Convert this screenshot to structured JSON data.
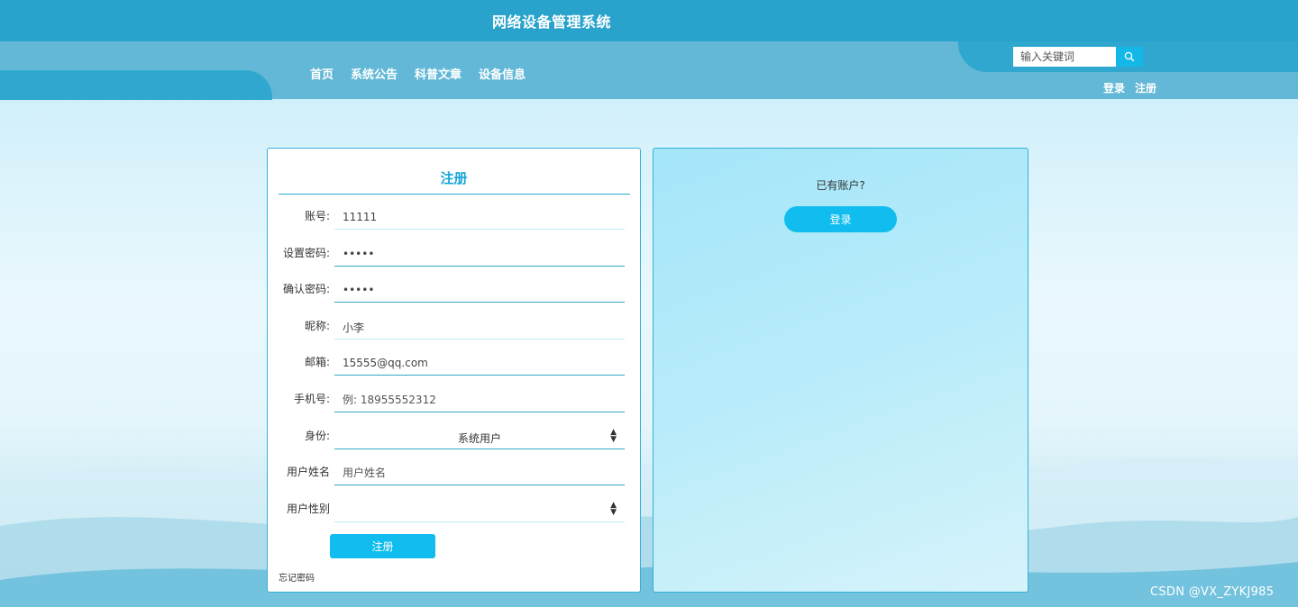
{
  "header": {
    "site_title": "网络设备管理系统",
    "nav_items": [
      "首页",
      "系统公告",
      "科普文章",
      "设备信息"
    ],
    "search_placeholder": "输入关键词",
    "login_link": "登录",
    "register_link": "注册"
  },
  "register_form": {
    "title": "注册",
    "fields": [
      {
        "label": "账号:",
        "value": "11111",
        "type": "text"
      },
      {
        "label": "设置密码:",
        "value": "•••••",
        "type": "password"
      },
      {
        "label": "确认密码:",
        "value": "•••••",
        "type": "password"
      },
      {
        "label": "昵称:",
        "value": "小李",
        "type": "text"
      },
      {
        "label": "邮箱:",
        "value": "15555@qq.com",
        "type": "text"
      },
      {
        "label": "手机号:",
        "value": "",
        "placeholder": "例: 18955552312",
        "type": "text"
      },
      {
        "label": "身份:",
        "value": "系统用户",
        "type": "select"
      },
      {
        "label": "用户姓名",
        "value": "",
        "placeholder": "用户姓名",
        "type": "text"
      },
      {
        "label": "用户性别",
        "value": "",
        "type": "select"
      }
    ],
    "submit_label": "注册",
    "forgot_label": "忘记密码"
  },
  "login_panel": {
    "prompt": "已有账户?",
    "login_label": "登录"
  },
  "watermark": "CSDN @VX_ZYKJ985",
  "colors": {
    "header_bg": "#29a3cc",
    "accent": "#10bdee",
    "panel_border": "#34b1d9",
    "title_color": "#16a6d8"
  }
}
